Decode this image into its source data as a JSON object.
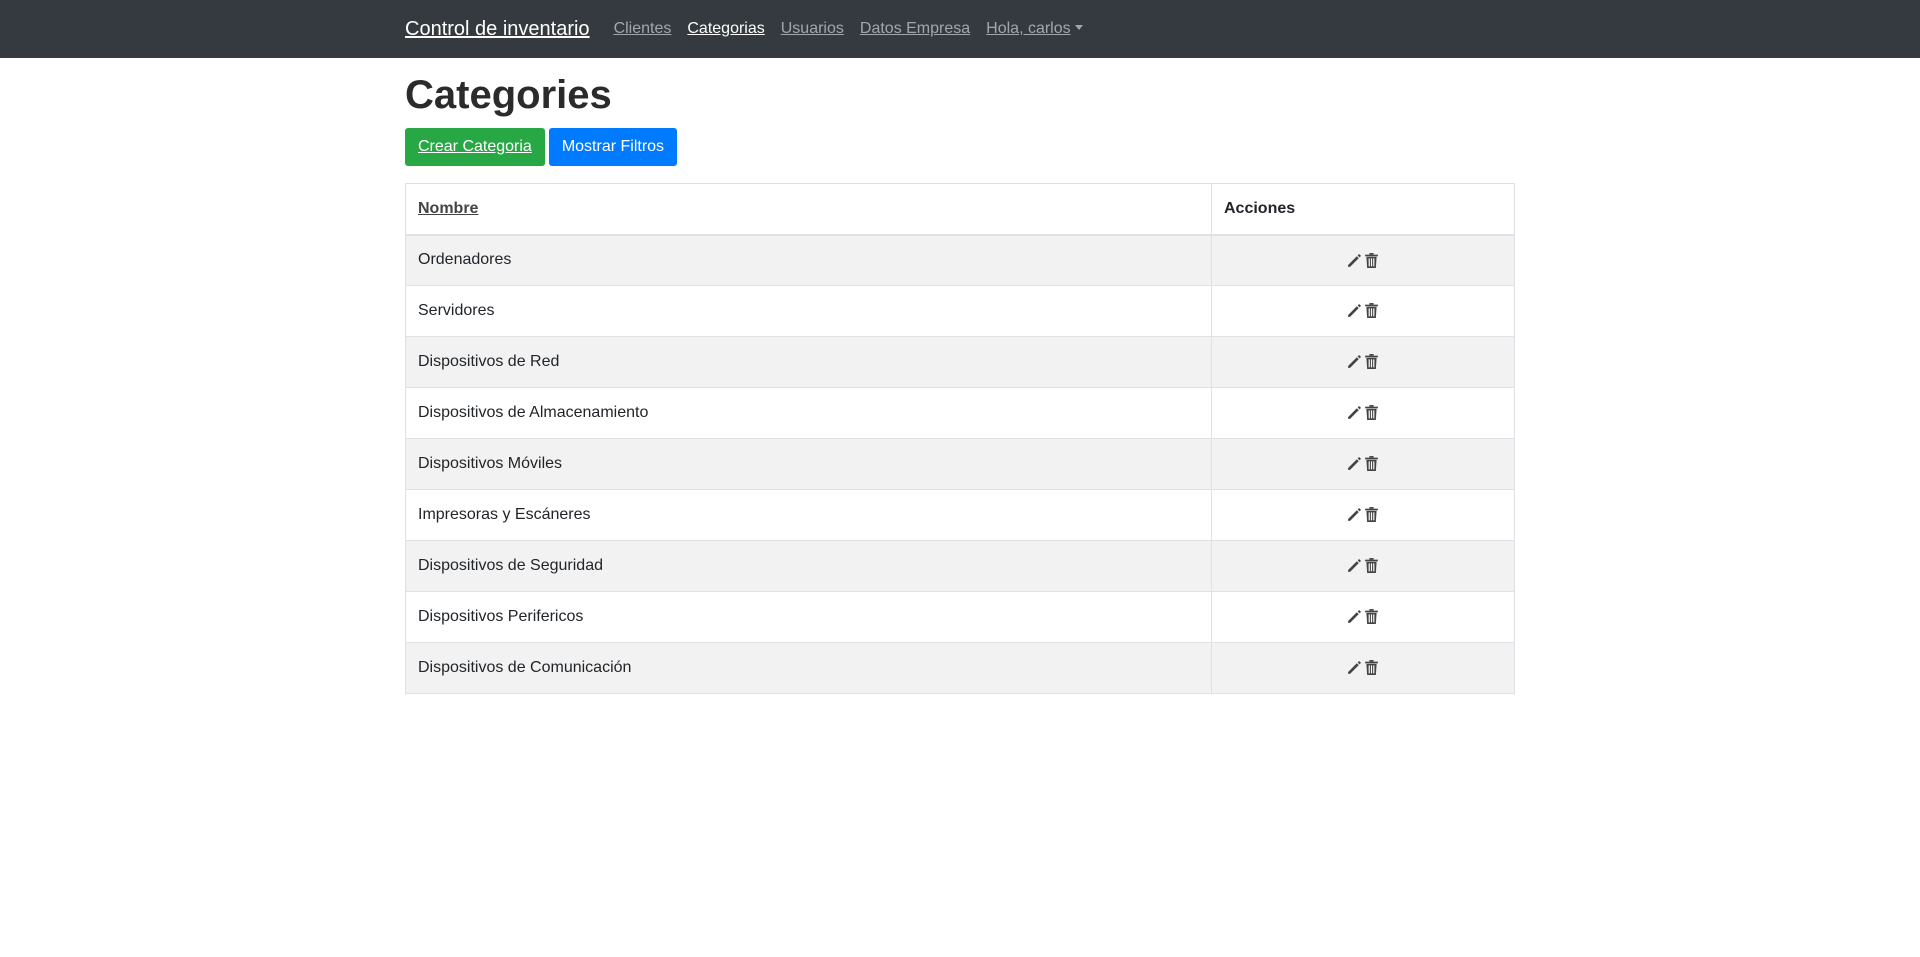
{
  "navbar": {
    "brand": "Control de inventario",
    "links": [
      {
        "label": "Clientes",
        "active": false
      },
      {
        "label": "Categorias",
        "active": true
      },
      {
        "label": "Usuarios",
        "active": false
      },
      {
        "label": "Datos Empresa",
        "active": false
      }
    ],
    "user_menu": "Hola, carlos"
  },
  "page": {
    "title": "Categories",
    "create_button": "Crear Categoria",
    "filters_button": "Mostrar Filtros"
  },
  "table": {
    "headers": {
      "name": "Nombre",
      "actions": "Acciones"
    },
    "rows": [
      {
        "name": "Ordenadores"
      },
      {
        "name": "Servidores"
      },
      {
        "name": "Dispositivos de Red"
      },
      {
        "name": "Dispositivos de Almacenamiento"
      },
      {
        "name": "Dispositivos Móviles"
      },
      {
        "name": "Impresoras y Escáneres"
      },
      {
        "name": "Dispositivos de Seguridad"
      },
      {
        "name": "Dispositivos Perifericos"
      },
      {
        "name": "Dispositivos de Comunicación"
      }
    ]
  },
  "icons": {
    "edit": "pencil-icon",
    "delete": "trash-icon"
  },
  "colors": {
    "navbar_bg": "#343a40",
    "success": "#28a745",
    "primary": "#007bff",
    "icon": "#444444"
  }
}
